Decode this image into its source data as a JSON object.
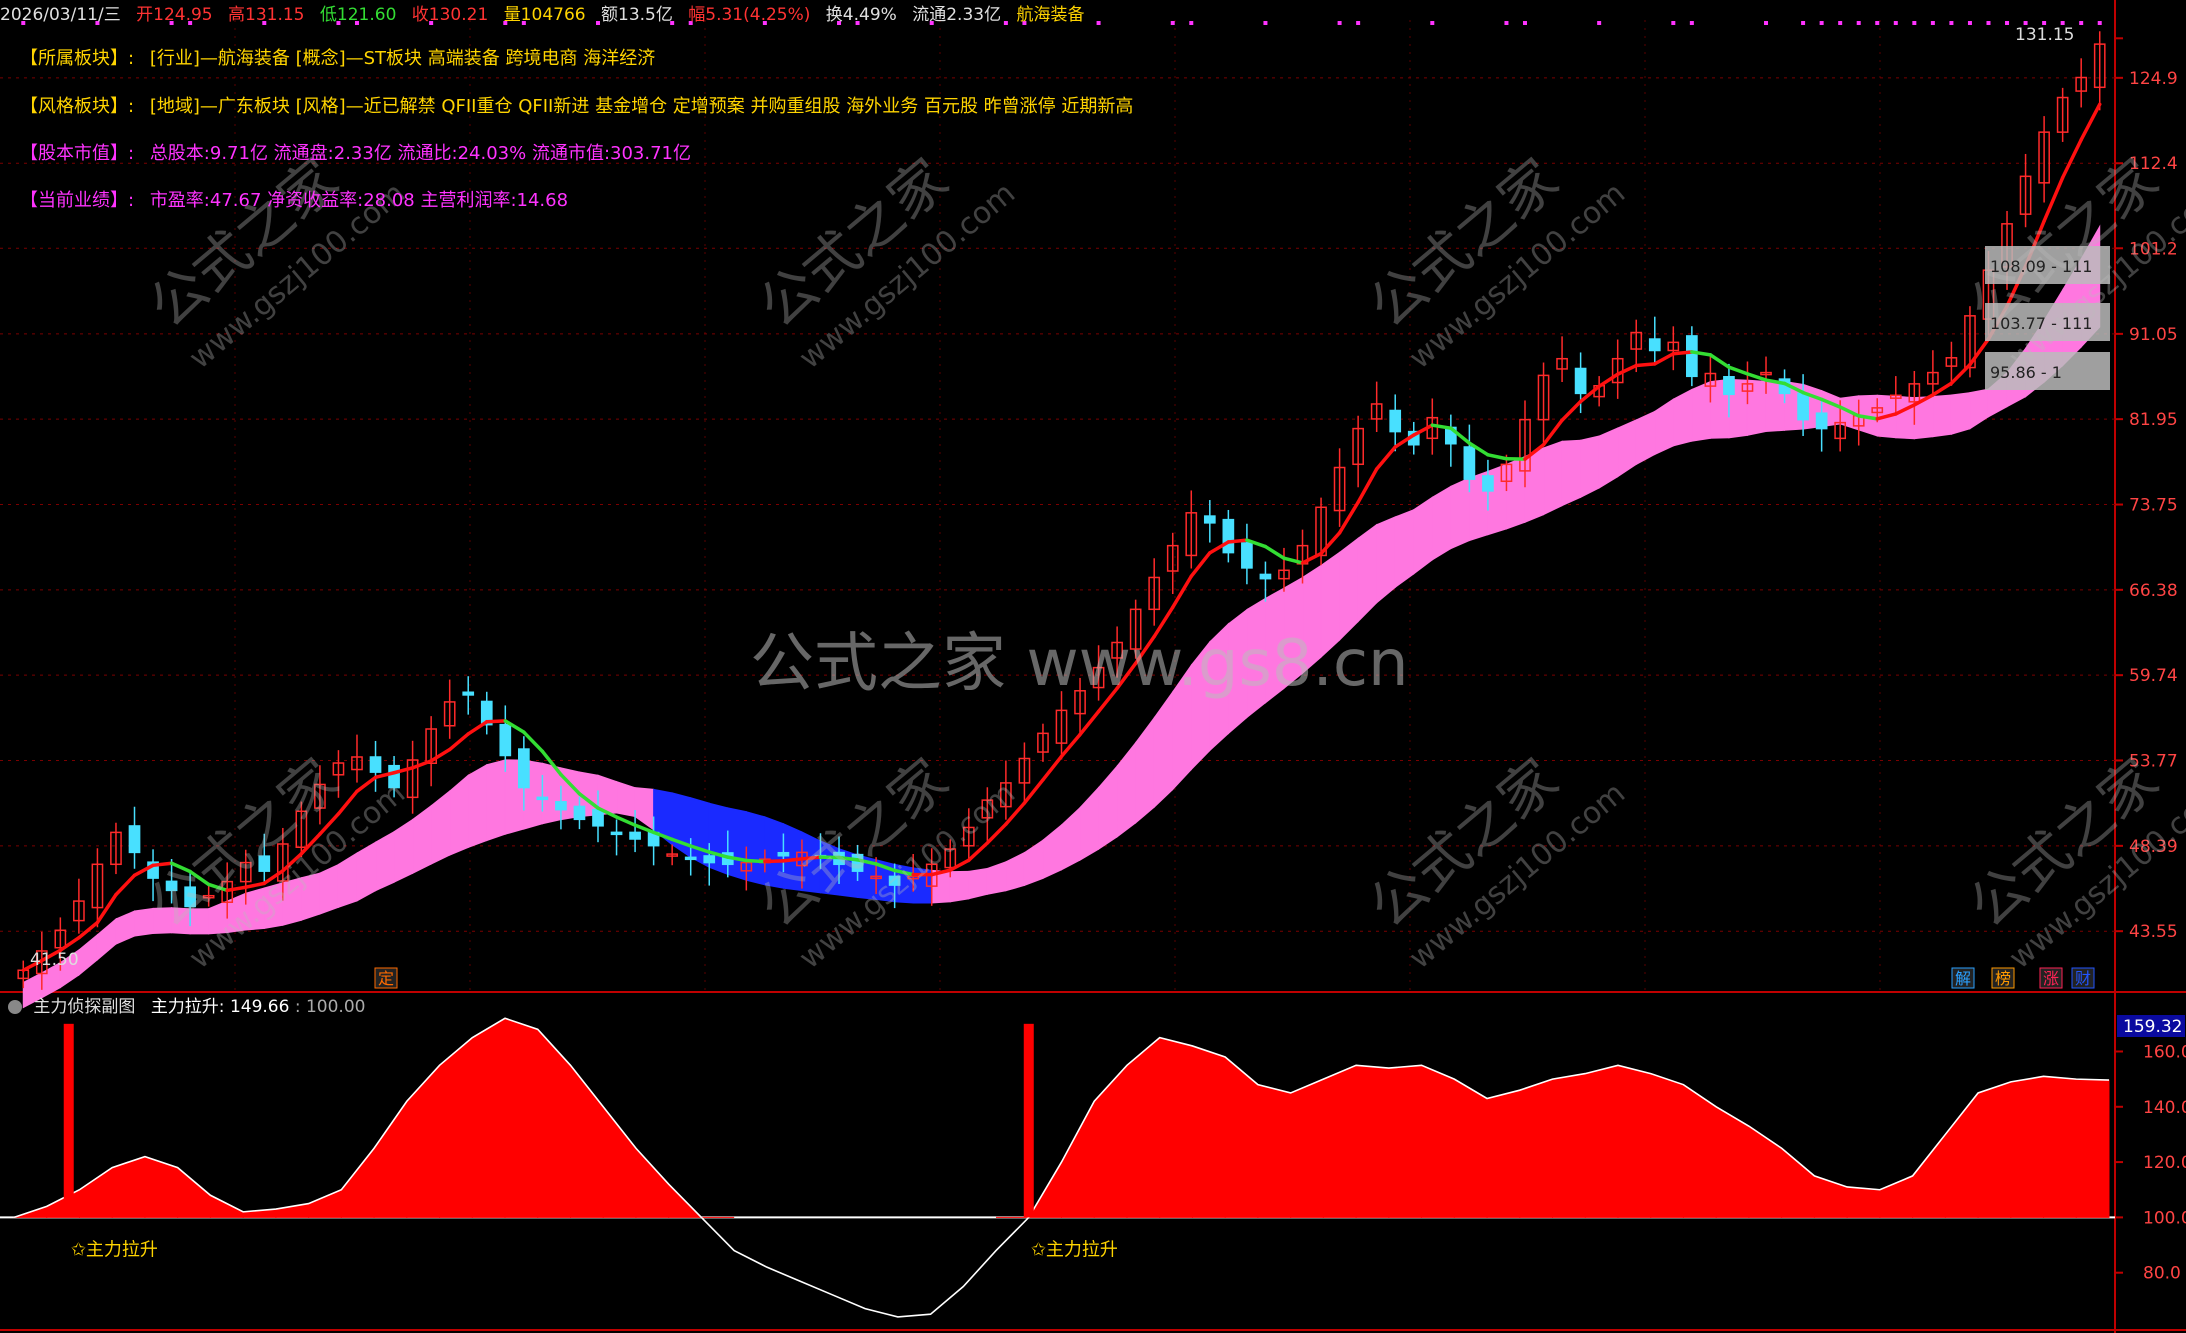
{
  "topbar": {
    "date": "2026/03/11/三",
    "open": "开124.95",
    "high": "高131.15",
    "low": "低121.60",
    "close": "收130.21",
    "volume": "量104766",
    "amount": "额13.5亿",
    "change": "幅5.31(4.25%)",
    "turnover": "换4.49%",
    "float": "流通2.33亿",
    "industry": "航海装备"
  },
  "info": {
    "sector_label": "【所属板块】:",
    "sector_value": "[行业]—航海装备 [概念]—ST板块 高端装备 跨境电商 海洋经济",
    "style_label": "【风格板块】:",
    "style_value": "[地域]—广东板块 [风格]—近已解禁 QFII重仓 QFII新进 基金增仓 定增预案 并购重组股 海外业务 百元股 昨曾涨停 近期新高",
    "cap_label": "【股本市值】:",
    "cap_value": "总股本:9.71亿 流通盘:2.33亿 流通比:24.03% 流通市值:303.71亿",
    "perf_label": "【当前业绩】:",
    "perf_value": "市盈率:47.67 净资收益率:28.08 主营利润率:14.68"
  },
  "watermark": {
    "center": "公式之家 www.gs8.cn",
    "diagonal": "公式之家",
    "diagonal_url": "www.gszj100.com"
  },
  "sub": {
    "title": "主力侦探副图",
    "indicator_label": "主力拉升: 149.66",
    "indicator_ref": ": 100.00",
    "signal_label": "✩主力拉升",
    "right_box_value": "159.32"
  },
  "badges": [
    "定",
    "解",
    "榜",
    "涨",
    "财"
  ],
  "right_marks": {
    "high_label": "131.15",
    "low_label": "41.50",
    "box1": "108.09 - 111",
    "box2": "103.77 - 111",
    "box3": "95.86 - 1"
  },
  "colors": {
    "up": "#ff2a2a",
    "down": "#48e0ff",
    "ma_red": "#ff1010",
    "ma_green": "#33dd33",
    "band_pink": "#ff77e0",
    "band_blue": "#1a2aff",
    "sub_fill": "#ff0000",
    "axis_red": "#c00000"
  },
  "chart_data": [
    {
      "type": "candlestick",
      "title": "",
      "y_ticks": [
        131.15,
        124.9,
        112.4,
        101.2,
        91.05,
        81.95,
        73.75,
        66.38,
        59.74,
        53.77,
        48.39,
        43.55
      ],
      "ylim": [
        40.5,
        132.5
      ],
      "log_scale": true,
      "grid": true,
      "closes": [
        41.5,
        42.5,
        43.6,
        45.2,
        47.3,
        49.2,
        48.0,
        46.5,
        45.8,
        44.9,
        45.5,
        46.3,
        47.4,
        46.9,
        48.5,
        50.5,
        52.2,
        53.6,
        54.0,
        53.0,
        52.0,
        53.8,
        55.9,
        57.8,
        58.3,
        56.2,
        54.1,
        52.0,
        51.3,
        50.6,
        50.0,
        49.6,
        49.2,
        48.8,
        48.4,
        47.9,
        47.6,
        47.4,
        47.3,
        47.4,
        47.6,
        47.8,
        48.0,
        47.8,
        47.3,
        46.9,
        46.6,
        46.1,
        46.6,
        47.3,
        48.2,
        49.5,
        51.2,
        52.3,
        53.9,
        55.6,
        57.2,
        58.6,
        60.3,
        62.2,
        64.8,
        67.4,
        70.1,
        73.0,
        72.1,
        69.5,
        68.2,
        67.3,
        68.0,
        70.1,
        73.5,
        77.2,
        81.0,
        83.5,
        80.7,
        79.4,
        82.1,
        79.5,
        76.1,
        75.0,
        77.5,
        81.9,
        86.5,
        88.3,
        84.6,
        85.4,
        88.3,
        91.2,
        89.2,
        90.1,
        86.4,
        86.7,
        84.5,
        85.6,
        86.8,
        84.6,
        81.9,
        81.0,
        81.6,
        82.3,
        83.1,
        84.4,
        85.6,
        86.8,
        88.4,
        93.1,
        98.5,
        104.3,
        110.6,
        116.8,
        121.9,
        124.95,
        130.21
      ],
      "ma_short_note": "red/green moving average",
      "band_note": "pink band = long-term channel"
    },
    {
      "type": "area",
      "title": "",
      "series": [
        {
          "name": "主力拉升",
          "values": [
            100,
            104,
            110,
            118,
            122,
            118,
            108,
            102,
            103,
            105,
            110,
            125,
            142,
            155,
            165,
            172,
            168,
            155,
            140,
            125,
            112,
            100,
            88,
            82,
            77,
            72,
            67,
            64,
            65,
            75,
            88,
            100,
            120,
            142,
            155,
            165,
            162,
            158,
            148,
            145,
            150,
            155,
            154,
            155,
            150,
            143,
            146,
            150,
            152,
            155,
            152,
            148,
            140,
            133,
            125,
            115,
            111,
            110,
            115,
            130,
            145,
            149,
            151,
            150,
            149.66
          ]
        }
      ],
      "reference_line": 100,
      "y_ticks": [
        160,
        140,
        120,
        100,
        80
      ],
      "ylim": [
        60,
        175
      ]
    }
  ]
}
